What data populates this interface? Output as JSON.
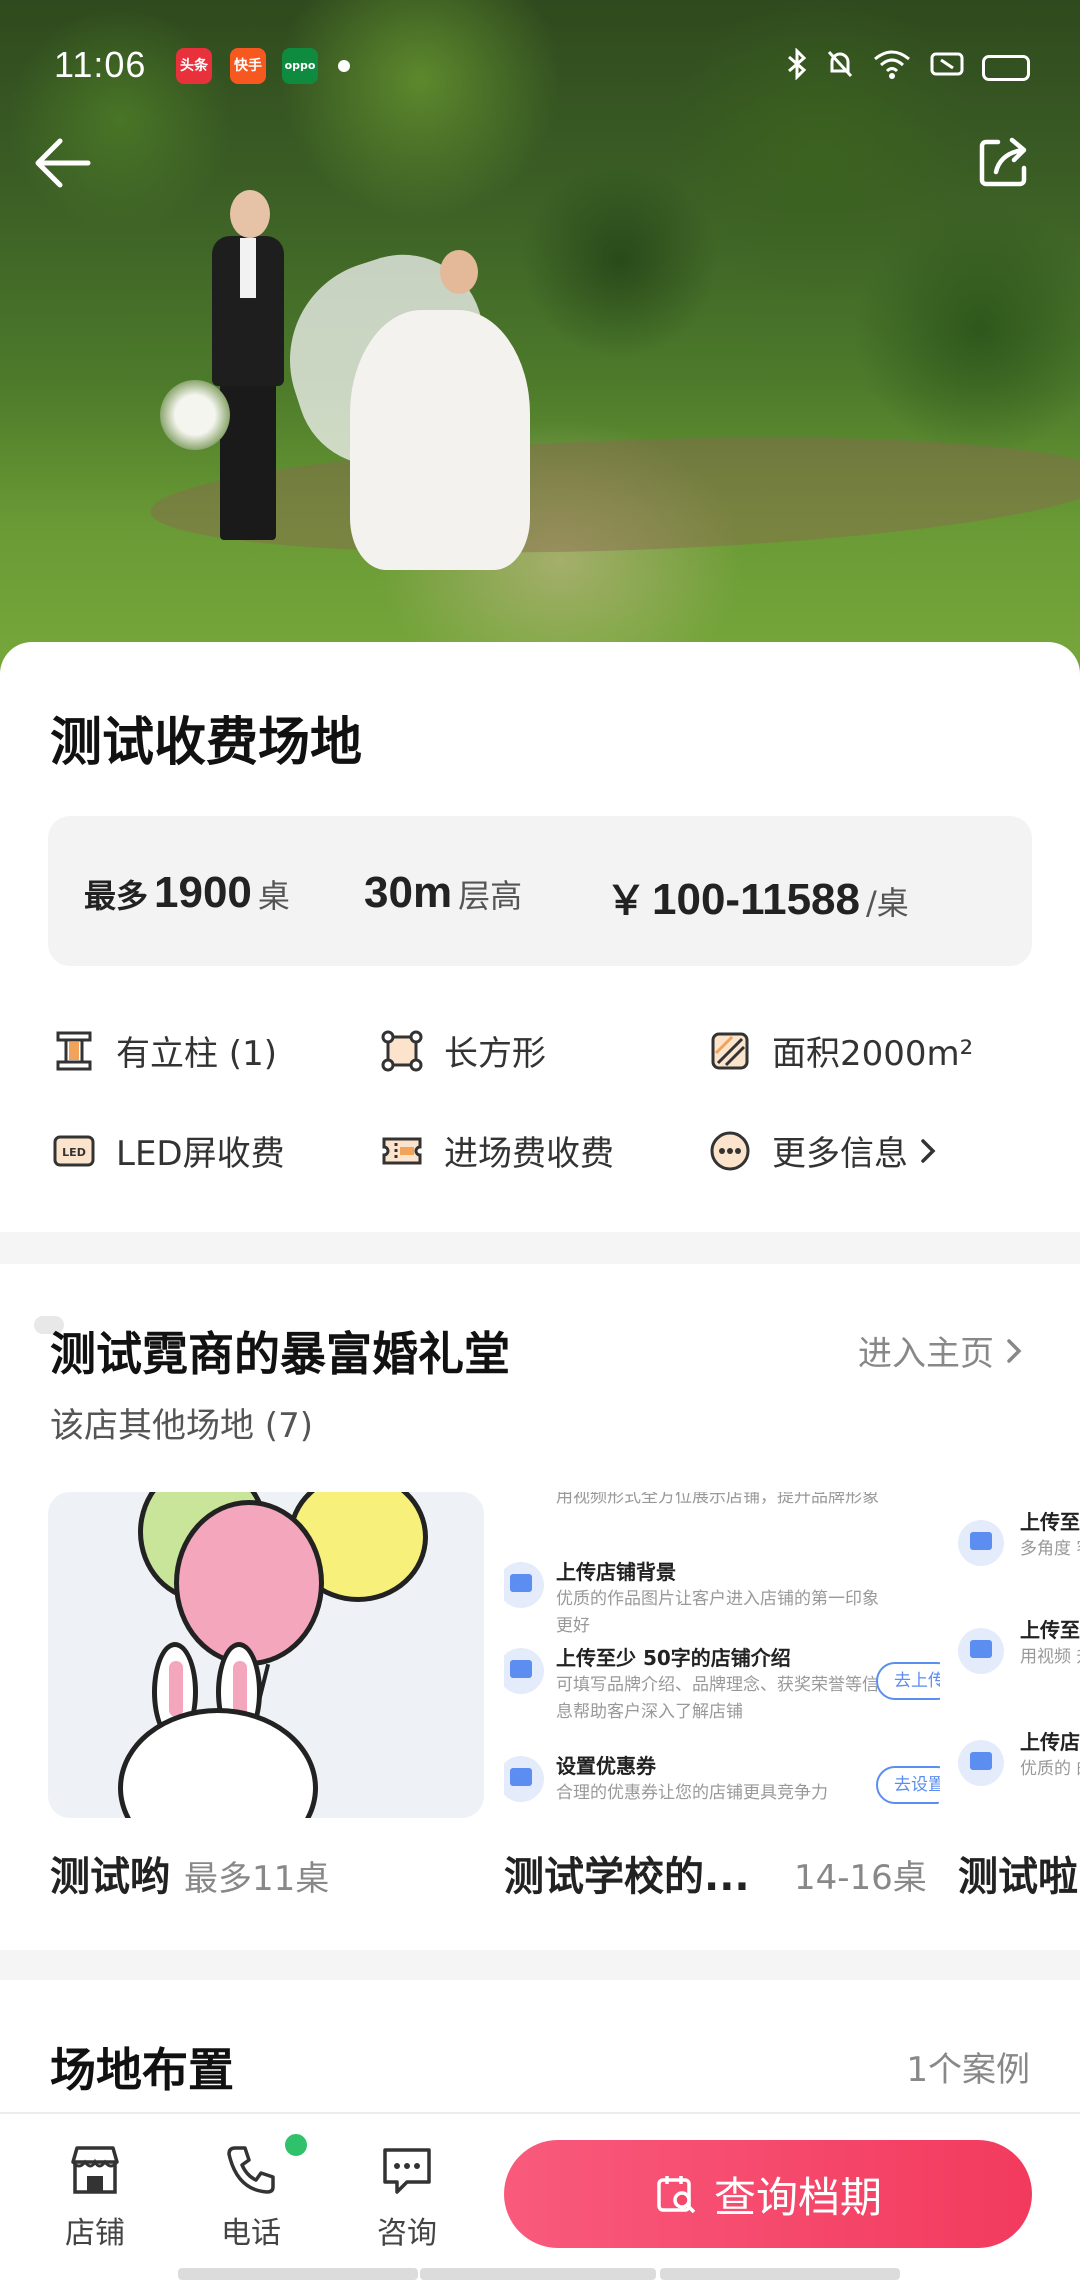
{
  "status_bar": {
    "time": "11:06",
    "app_badges": [
      "头条",
      "快手",
      "oppo"
    ]
  },
  "hero": {
    "back_icon": "arrow-left-icon",
    "share_icon": "share-icon"
  },
  "venue": {
    "title": "测试收费场地",
    "stats": {
      "capacity_prefix": "最多",
      "capacity_value": "1900",
      "capacity_unit": "桌",
      "height_value": "30m",
      "height_unit": "层高",
      "price_currency": "￥",
      "price_value": "100-11588",
      "price_unit": "/桌"
    },
    "features": [
      {
        "label": "有立柱 (1)",
        "icon": "pillar-icon"
      },
      {
        "label": "长方形",
        "icon": "rectangle-shape-icon"
      },
      {
        "label": "面积2000m²",
        "icon": "area-icon"
      },
      {
        "label": "LED屏收费",
        "icon": "led-icon"
      },
      {
        "label": "进场费收费",
        "icon": "ticket-icon"
      },
      {
        "label": "更多信息",
        "icon": "more-dots-icon"
      }
    ]
  },
  "store": {
    "name": "测试霓商的暴富婚礼堂",
    "link": "进入主页",
    "sub": "该店其他场地 (7)",
    "venues": [
      {
        "name": "测试哟",
        "info": "最多11桌"
      },
      {
        "name": "测试学校的...",
        "info": "14-16桌"
      },
      {
        "name": "测试啦",
        "info": ""
      }
    ],
    "thumb2_tips": [
      {
        "desc": "用视频形式全方位展示店铺，提升品牌形象"
      },
      {
        "title": "上传店铺背景",
        "desc": "优质的作品图片让客户进入店铺的第一印象更好"
      },
      {
        "title": "上传至少 50字的店铺介绍",
        "desc": "可填写品牌介绍、品牌理念、获奖荣誉等信息帮助客户深入了解店铺",
        "button": "去上传"
      },
      {
        "title": "设置优惠券",
        "desc": "合理的优惠券让您的店铺更具竞争力",
        "button": "去设置"
      }
    ],
    "thumb3_tips": [
      {
        "title": "上传至",
        "desc": "多角度 客户了"
      },
      {
        "title": "上传至",
        "desc": "用视频 升品牌"
      },
      {
        "title": "上传店",
        "desc": "优质的 的第一"
      }
    ]
  },
  "layout_section": {
    "title": "场地布置",
    "count": "1个案例"
  },
  "bottom_bar": {
    "tabs": [
      {
        "label": "店铺",
        "icon": "store-icon"
      },
      {
        "label": "电话",
        "icon": "phone-icon"
      },
      {
        "label": "咨询",
        "icon": "chat-icon"
      }
    ],
    "cta": "查询档期"
  },
  "colors": {
    "accent": "#F23A5E",
    "accent_light": "#F95A7C",
    "link_blue": "#5B8EF0",
    "check_green": "#2FC26A"
  }
}
